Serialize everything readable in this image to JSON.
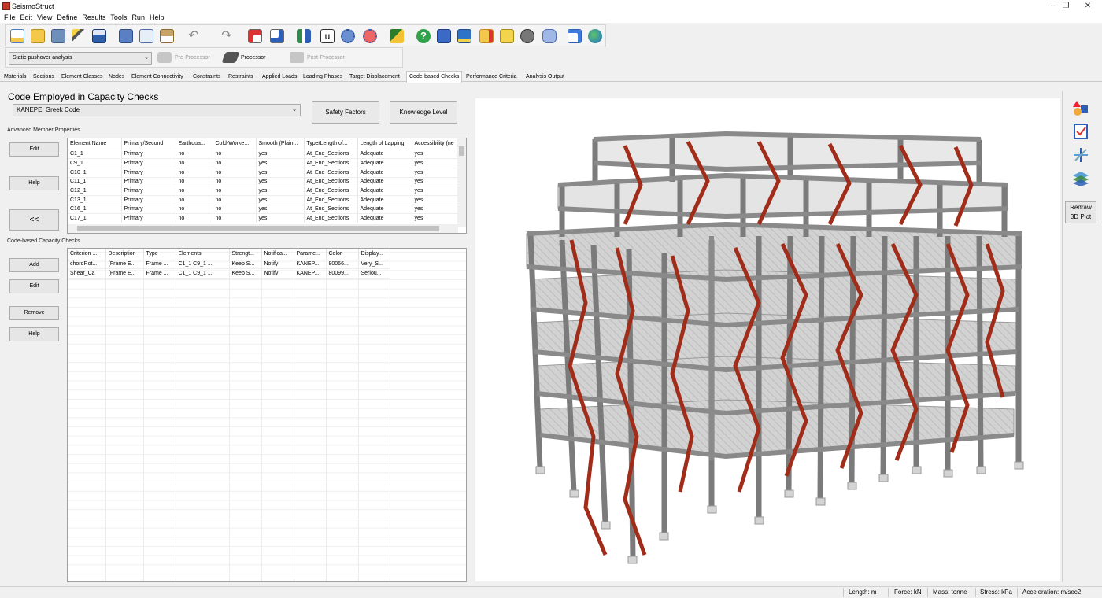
{
  "app": {
    "title": "SeismoStruct"
  },
  "menu": [
    "File",
    "Edit",
    "View",
    "Define",
    "Results",
    "Tools",
    "Run",
    "Help"
  ],
  "analysis_type": "Static pushover analysis",
  "phases": {
    "pre": "Pre-Processor",
    "proc": "Processor",
    "post": "Post-Processor"
  },
  "tabs": [
    "Materials",
    "Sections",
    "Element Classes",
    "Nodes",
    "Element Connectivity",
    "Constraints",
    "Restraints",
    "Applied Loads",
    "Loading Phases",
    "Target Displacement",
    "Code-based Checks",
    "Performance Criteria",
    "Analysis Output"
  ],
  "capacity": {
    "heading": "Code Employed in Capacity Checks",
    "code": "KANEPE, Greek Code",
    "safety_factors": "Safety Factors",
    "knowledge_level": "Knowledge Level"
  },
  "amp": {
    "label": "Advanced Member Properties",
    "edit": "Edit",
    "help": "Help",
    "collapse": "<<",
    "columns": [
      "Element Name",
      "Primary/Second",
      "Earthqua...",
      "Cold-Worke...",
      "Smooth (Plain...",
      "Type/Length of...",
      "Length of Lapping",
      "Accessibility (ne"
    ],
    "rows": [
      [
        "C1_1",
        "Primary",
        "no",
        "no",
        "yes",
        "At_End_Sections",
        "Adequate",
        "yes"
      ],
      [
        "C9_1",
        "Primary",
        "no",
        "no",
        "yes",
        "At_End_Sections",
        "Adequate",
        "yes"
      ],
      [
        "C10_1",
        "Primary",
        "no",
        "no",
        "yes",
        "At_End_Sections",
        "Adequate",
        "yes"
      ],
      [
        "C11_1",
        "Primary",
        "no",
        "no",
        "yes",
        "At_End_Sections",
        "Adequate",
        "yes"
      ],
      [
        "C12_1",
        "Primary",
        "no",
        "no",
        "yes",
        "At_End_Sections",
        "Adequate",
        "yes"
      ],
      [
        "C13_1",
        "Primary",
        "no",
        "no",
        "yes",
        "At_End_Sections",
        "Adequate",
        "yes"
      ],
      [
        "C16_1",
        "Primary",
        "no",
        "no",
        "yes",
        "At_End_Sections",
        "Adequate",
        "yes"
      ],
      [
        "C17_1",
        "Primary",
        "no",
        "no",
        "yes",
        "At_End_Sections",
        "Adequate",
        "yes"
      ]
    ]
  },
  "cbc": {
    "label": "Code-based Capacity Checks",
    "add": "Add",
    "edit": "Edit",
    "remove": "Remove",
    "help": "Help",
    "columns": [
      "Criterion ...",
      "Description",
      "Type",
      "Elements",
      "Strengt...",
      "Notifica...",
      "Parame...",
      "Color",
      "Display..."
    ],
    "rows": [
      [
        "chordRot...",
        "(Frame E...",
        "Frame ...",
        "C1_1  C9_1  ...",
        "Keep S...",
        "Notify",
        "KANEP...",
        "80066...",
        "Very_S..."
      ],
      [
        "Shear_Ca",
        "(Frame E...",
        "Frame ...",
        "C1_1  C9_1  ...",
        "Keep S...",
        "Notify",
        "KANEP...",
        "80099...",
        "Seriou..."
      ]
    ]
  },
  "sidebar": {
    "redraw": "Redraw",
    "plot3d": "3D Plot"
  },
  "status": {
    "length": "Length: m",
    "force": "Force: kN",
    "mass": "Mass: tonne",
    "stress": "Stress: kPa",
    "accel": "Acceleration: m/sec2"
  },
  "colors": {
    "frame": "#8c8c8c",
    "brace": "#a02c1a",
    "slab": "#bdbdbd",
    "accent": "#c0392b"
  }
}
